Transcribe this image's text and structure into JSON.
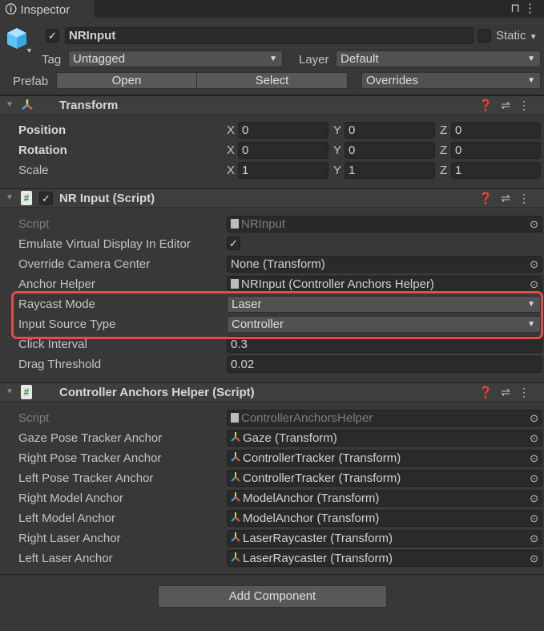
{
  "tab": {
    "title": "Inspector",
    "icon": "info-icon",
    "lock_icon": "lock-icon",
    "menu_icon": "kebab-icon"
  },
  "object": {
    "name": "NRInput",
    "active": true,
    "static_label": "Static",
    "static": false,
    "tag_label": "Tag",
    "tag": "Untagged",
    "layer_label": "Layer",
    "layer": "Default",
    "prefab_label": "Prefab",
    "open": "Open",
    "select": "Select",
    "overrides": "Overrides"
  },
  "transform": {
    "title": "Transform",
    "rows": [
      {
        "label": "Position",
        "bold": true,
        "x": "0",
        "y": "0",
        "z": "0"
      },
      {
        "label": "Rotation",
        "bold": true,
        "x": "0",
        "y": "0",
        "z": "0"
      },
      {
        "label": "Scale",
        "bold": false,
        "x": "1",
        "y": "1",
        "z": "1"
      }
    ],
    "axis": [
      "X",
      "Y",
      "Z"
    ]
  },
  "nrinput": {
    "title": "NR Input (Script)",
    "enabled": true,
    "rows": [
      {
        "label": "Script",
        "type": "obj",
        "value": "NRInput",
        "icon": "script",
        "disabled": true
      },
      {
        "label": "Emulate Virtual Display In Editor",
        "type": "check",
        "checked": true
      },
      {
        "label": "Override Camera Center",
        "type": "obj",
        "value": "None (Transform)"
      },
      {
        "label": "Anchor Helper",
        "type": "obj",
        "value": "NRInput (Controller Anchors Helper)",
        "icon": "script"
      },
      {
        "label": "Raycast Mode",
        "type": "drop",
        "value": "Laser"
      },
      {
        "label": "Input Source Type",
        "type": "drop",
        "value": "Controller"
      },
      {
        "label": "Click Interval",
        "type": "text",
        "value": "0.3"
      },
      {
        "label": "Drag Threshold",
        "type": "text",
        "value": "0.02"
      }
    ]
  },
  "anchors": {
    "title": "Controller Anchors Helper (Script)",
    "rows": [
      {
        "label": "Script",
        "type": "obj",
        "value": "ControllerAnchorsHelper",
        "icon": "script",
        "disabled": true
      },
      {
        "label": "Gaze Pose Tracker Anchor",
        "type": "obj",
        "value": "Gaze (Transform)",
        "icon": "transform"
      },
      {
        "label": "Right Pose Tracker Anchor",
        "type": "obj",
        "value": "ControllerTracker (Transform)",
        "icon": "transform"
      },
      {
        "label": "Left Pose Tracker Anchor",
        "type": "obj",
        "value": "ControllerTracker (Transform)",
        "icon": "transform"
      },
      {
        "label": "Right Model Anchor",
        "type": "obj",
        "value": "ModelAnchor (Transform)",
        "icon": "transform"
      },
      {
        "label": "Left Model Anchor",
        "type": "obj",
        "value": "ModelAnchor (Transform)",
        "icon": "transform"
      },
      {
        "label": "Right Laser Anchor",
        "type": "obj",
        "value": "LaserRaycaster (Transform)",
        "icon": "transform"
      },
      {
        "label": "Left Laser Anchor",
        "type": "obj",
        "value": "LaserRaycaster (Transform)",
        "icon": "transform"
      }
    ]
  },
  "add_component": "Add Component",
  "highlight_color": "#e84a4a"
}
